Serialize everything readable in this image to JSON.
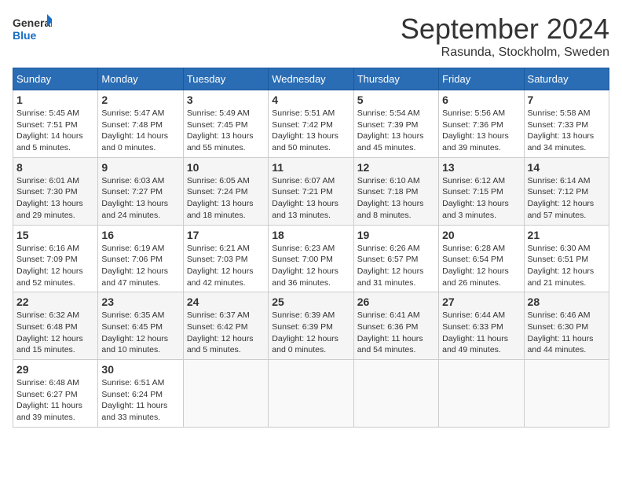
{
  "header": {
    "logo_line1": "General",
    "logo_line2": "Blue",
    "month": "September 2024",
    "location": "Rasunda, Stockholm, Sweden"
  },
  "columns": [
    "Sunday",
    "Monday",
    "Tuesday",
    "Wednesday",
    "Thursday",
    "Friday",
    "Saturday"
  ],
  "weeks": [
    [
      {
        "day": "1",
        "info": "Sunrise: 5:45 AM\nSunset: 7:51 PM\nDaylight: 14 hours\nand 5 minutes."
      },
      {
        "day": "2",
        "info": "Sunrise: 5:47 AM\nSunset: 7:48 PM\nDaylight: 14 hours\nand 0 minutes."
      },
      {
        "day": "3",
        "info": "Sunrise: 5:49 AM\nSunset: 7:45 PM\nDaylight: 13 hours\nand 55 minutes."
      },
      {
        "day": "4",
        "info": "Sunrise: 5:51 AM\nSunset: 7:42 PM\nDaylight: 13 hours\nand 50 minutes."
      },
      {
        "day": "5",
        "info": "Sunrise: 5:54 AM\nSunset: 7:39 PM\nDaylight: 13 hours\nand 45 minutes."
      },
      {
        "day": "6",
        "info": "Sunrise: 5:56 AM\nSunset: 7:36 PM\nDaylight: 13 hours\nand 39 minutes."
      },
      {
        "day": "7",
        "info": "Sunrise: 5:58 AM\nSunset: 7:33 PM\nDaylight: 13 hours\nand 34 minutes."
      }
    ],
    [
      {
        "day": "8",
        "info": "Sunrise: 6:01 AM\nSunset: 7:30 PM\nDaylight: 13 hours\nand 29 minutes."
      },
      {
        "day": "9",
        "info": "Sunrise: 6:03 AM\nSunset: 7:27 PM\nDaylight: 13 hours\nand 24 minutes."
      },
      {
        "day": "10",
        "info": "Sunrise: 6:05 AM\nSunset: 7:24 PM\nDaylight: 13 hours\nand 18 minutes."
      },
      {
        "day": "11",
        "info": "Sunrise: 6:07 AM\nSunset: 7:21 PM\nDaylight: 13 hours\nand 13 minutes."
      },
      {
        "day": "12",
        "info": "Sunrise: 6:10 AM\nSunset: 7:18 PM\nDaylight: 13 hours\nand 8 minutes."
      },
      {
        "day": "13",
        "info": "Sunrise: 6:12 AM\nSunset: 7:15 PM\nDaylight: 13 hours\nand 3 minutes."
      },
      {
        "day": "14",
        "info": "Sunrise: 6:14 AM\nSunset: 7:12 PM\nDaylight: 12 hours\nand 57 minutes."
      }
    ],
    [
      {
        "day": "15",
        "info": "Sunrise: 6:16 AM\nSunset: 7:09 PM\nDaylight: 12 hours\nand 52 minutes."
      },
      {
        "day": "16",
        "info": "Sunrise: 6:19 AM\nSunset: 7:06 PM\nDaylight: 12 hours\nand 47 minutes."
      },
      {
        "day": "17",
        "info": "Sunrise: 6:21 AM\nSunset: 7:03 PM\nDaylight: 12 hours\nand 42 minutes."
      },
      {
        "day": "18",
        "info": "Sunrise: 6:23 AM\nSunset: 7:00 PM\nDaylight: 12 hours\nand 36 minutes."
      },
      {
        "day": "19",
        "info": "Sunrise: 6:26 AM\nSunset: 6:57 PM\nDaylight: 12 hours\nand 31 minutes."
      },
      {
        "day": "20",
        "info": "Sunrise: 6:28 AM\nSunset: 6:54 PM\nDaylight: 12 hours\nand 26 minutes."
      },
      {
        "day": "21",
        "info": "Sunrise: 6:30 AM\nSunset: 6:51 PM\nDaylight: 12 hours\nand 21 minutes."
      }
    ],
    [
      {
        "day": "22",
        "info": "Sunrise: 6:32 AM\nSunset: 6:48 PM\nDaylight: 12 hours\nand 15 minutes."
      },
      {
        "day": "23",
        "info": "Sunrise: 6:35 AM\nSunset: 6:45 PM\nDaylight: 12 hours\nand 10 minutes."
      },
      {
        "day": "24",
        "info": "Sunrise: 6:37 AM\nSunset: 6:42 PM\nDaylight: 12 hours\nand 5 minutes."
      },
      {
        "day": "25",
        "info": "Sunrise: 6:39 AM\nSunset: 6:39 PM\nDaylight: 12 hours\nand 0 minutes."
      },
      {
        "day": "26",
        "info": "Sunrise: 6:41 AM\nSunset: 6:36 PM\nDaylight: 11 hours\nand 54 minutes."
      },
      {
        "day": "27",
        "info": "Sunrise: 6:44 AM\nSunset: 6:33 PM\nDaylight: 11 hours\nand 49 minutes."
      },
      {
        "day": "28",
        "info": "Sunrise: 6:46 AM\nSunset: 6:30 PM\nDaylight: 11 hours\nand 44 minutes."
      }
    ],
    [
      {
        "day": "29",
        "info": "Sunrise: 6:48 AM\nSunset: 6:27 PM\nDaylight: 11 hours\nand 39 minutes."
      },
      {
        "day": "30",
        "info": "Sunrise: 6:51 AM\nSunset: 6:24 PM\nDaylight: 11 hours\nand 33 minutes."
      },
      {
        "day": "",
        "info": ""
      },
      {
        "day": "",
        "info": ""
      },
      {
        "day": "",
        "info": ""
      },
      {
        "day": "",
        "info": ""
      },
      {
        "day": "",
        "info": ""
      }
    ]
  ]
}
